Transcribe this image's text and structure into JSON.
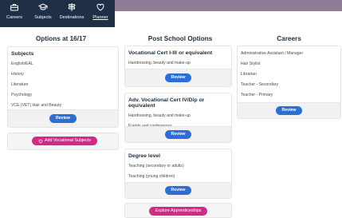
{
  "nav": {
    "items": [
      {
        "label": "Careers",
        "icon": "briefcase-icon"
      },
      {
        "label": "Subjects",
        "icon": "graduation-cap-icon"
      },
      {
        "label": "Destinations",
        "icon": "signpost-icon"
      },
      {
        "label": "Planner",
        "icon": "heart-icon",
        "active": true
      }
    ]
  },
  "columns": {
    "options": {
      "title": "Options at 16/17",
      "subjects_card": {
        "title": "Subjects",
        "items": [
          "English/EAL",
          "History",
          "Literature",
          "Psychology",
          "VCE (VET) Hair and Beauty"
        ],
        "review_label": "Review"
      },
      "add_vocational_label": "Add Vocational Subjects"
    },
    "post_school": {
      "title": "Post School Options",
      "cards": [
        {
          "title": "Vocational Cert I-III or equivalent",
          "items": [
            "Hairdressing, beauty and make-up"
          ],
          "review_label": "Review"
        },
        {
          "title": "Adv. Vocational Cert IV/Dip or equivalent",
          "items": [
            "Hairdressing, beauty and make-up",
            "Events and conferences"
          ],
          "review_label": "Review"
        },
        {
          "title": "Degree level",
          "items": [
            "Teaching (secondary or adults)",
            "Teaching (young children)"
          ],
          "review_label": "Review"
        }
      ],
      "apprenticeships_label": "Explore Apprenticeships"
    },
    "careers": {
      "title": "Careers",
      "items": [
        "Administrative Assistant / Manager",
        "Hair Stylist",
        "Librarian",
        "Teacher - Secondary",
        "Teacher - Primary"
      ],
      "review_label": "Review"
    }
  },
  "colors": {
    "nav_bg": "#1f2f46",
    "accent_blue": "#2b6fd6",
    "accent_pink": "#d42a86",
    "header_strip": "#8f7d95"
  }
}
